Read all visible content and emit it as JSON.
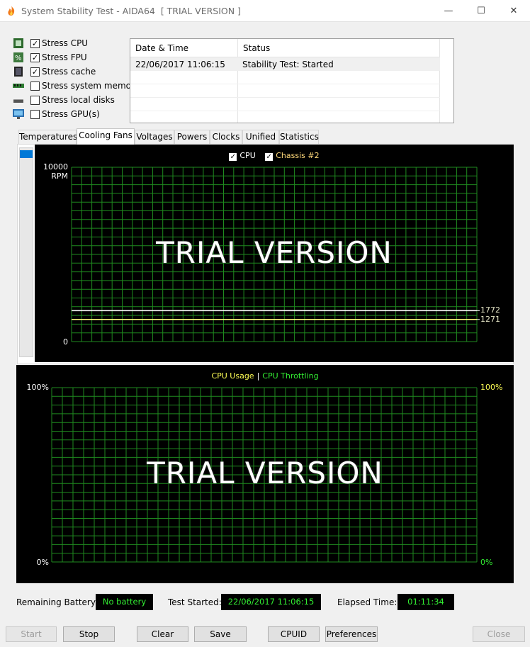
{
  "window": {
    "title": "System Stability Test - AIDA64  [ TRIAL VERSION ]",
    "minimize": "—",
    "maximize": "☐",
    "close": "✕"
  },
  "stress_options": [
    {
      "label": "Stress CPU",
      "checked": true,
      "icon": "cpu-chip-icon"
    },
    {
      "label": "Stress FPU",
      "checked": true,
      "icon": "fpu-icon"
    },
    {
      "label": "Stress cache",
      "checked": true,
      "icon": "cache-chip-icon"
    },
    {
      "label": "Stress system memory",
      "checked": false,
      "icon": "memory-module-icon"
    },
    {
      "label": "Stress local disks",
      "checked": false,
      "icon": "disk-drive-icon"
    },
    {
      "label": "Stress GPU(s)",
      "checked": false,
      "icon": "monitor-icon"
    }
  ],
  "status_table": {
    "headers": [
      "Date & Time",
      "Status"
    ],
    "rows": [
      [
        "22/06/2017 11:06:15",
        "Stability Test: Started"
      ]
    ]
  },
  "tabs": [
    "Temperatures",
    "Cooling Fans",
    "Voltages",
    "Powers",
    "Clocks",
    "Unified",
    "Statistics"
  ],
  "active_tab": "Cooling Fans",
  "fan_graph": {
    "legend": [
      {
        "label": "CPU",
        "checked": true
      },
      {
        "label": "Chassis #2",
        "checked": true
      }
    ],
    "y_max_label": "10000",
    "y_unit_label": "RPM",
    "y_min_label": "0",
    "watermark": "TRIAL VERSION",
    "series_values": [
      "1772",
      "1271"
    ],
    "colors": {
      "cpu_line": "#ffffff",
      "chassis_line": "#ffff80",
      "grid": "#1f8a1f"
    }
  },
  "chart_data": {
    "type": "line",
    "ylim": [
      0,
      10000
    ],
    "ylabel": "RPM",
    "series": [
      {
        "name": "CPU",
        "values": [
          1772
        ]
      },
      {
        "name": "Chassis #2",
        "values": [
          1271
        ]
      }
    ]
  },
  "usage_graph": {
    "legend_usage": "CPU Usage",
    "legend_separator": "|",
    "legend_throttling": "CPU Throttling",
    "left_top": "100%",
    "left_bottom": "0%",
    "right_top": "100%",
    "right_bottom": "0%",
    "watermark": "TRIAL VERSION",
    "colors": {
      "usage": "#ffff55",
      "throttling": "#33ee33",
      "grid": "#1f8a1f"
    }
  },
  "info": {
    "battery_label": "Remaining Battery:",
    "battery_value": "No battery",
    "started_label": "Test Started:",
    "started_value": "22/06/2017 11:06:15",
    "elapsed_label": "Elapsed Time:",
    "elapsed_value": "01:11:34"
  },
  "buttons": {
    "start": "Start",
    "stop": "Stop",
    "clear": "Clear",
    "save": "Save",
    "cpuid": "CPUID",
    "preferences": "Preferences",
    "close": "Close"
  }
}
